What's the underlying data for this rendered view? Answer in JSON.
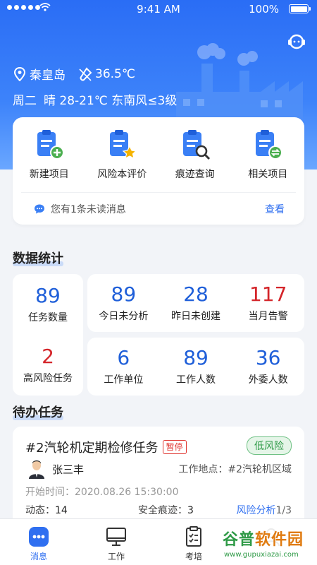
{
  "status_bar": {
    "time": "9:41 AM",
    "battery": "100%"
  },
  "header": {
    "location": "秦皇岛",
    "temperature": "36.5℃",
    "weekday": "周二",
    "weather": "晴 28-21℃ 东南风≤3级"
  },
  "quick_actions": [
    {
      "label": "新建项目",
      "icon": "clipboard-add-icon"
    },
    {
      "label": "风险本评价",
      "icon": "clipboard-star-icon"
    },
    {
      "label": "痕迹查询",
      "icon": "clipboard-search-icon"
    },
    {
      "label": "相关项目",
      "icon": "clipboard-link-icon"
    }
  ],
  "notice": {
    "text": "您有1条未读消息",
    "action": "查看"
  },
  "stats": {
    "title": "数据统计",
    "items": [
      {
        "value": "89",
        "label": "任务数量",
        "color": "#1f5fd9"
      },
      {
        "value": "2",
        "label": "高风险任务",
        "color": "#d4252a"
      },
      {
        "value": "89",
        "label": "今日未分析",
        "color": "#1f5fd9"
      },
      {
        "value": "28",
        "label": "昨日未创建",
        "color": "#1f5fd9"
      },
      {
        "value": "117",
        "label": "当月告警",
        "color": "#d4252a"
      },
      {
        "value": "6",
        "label": "工作单位",
        "color": "#1f5fd9"
      },
      {
        "value": "89",
        "label": "工作人数",
        "color": "#1f5fd9"
      },
      {
        "value": "36",
        "label": "外委人数",
        "color": "#1f5fd9"
      }
    ]
  },
  "todo": {
    "title": "待办任务",
    "task": {
      "title": "#2汽轮机定期检修任务",
      "tag": "暂停",
      "risk": "低风险",
      "person": "张三丰",
      "workplace": "工作地点：#2汽轮机区域",
      "start_time": "开始时间：2020.08.26  15:30:00",
      "dynamic_label": "动态：",
      "dynamic_value": "14",
      "trace_label": "安全痕迹：",
      "trace_value": "3",
      "analysis_label": "风险分析",
      "analysis_progress": "1/3"
    }
  },
  "tabs": [
    {
      "label": "消息",
      "icon": "message-dots-icon",
      "active": true
    },
    {
      "label": "工作",
      "icon": "monitor-icon",
      "active": false
    },
    {
      "label": "考培",
      "icon": "checklist-icon",
      "active": false
    },
    {
      "label": "",
      "icon": "profile-icon",
      "active": false
    }
  ],
  "watermark": {
    "main_green": "谷普",
    "main_orange": "软件园",
    "url": "www.gupuxiazai.com"
  },
  "colors": {
    "primary": "#2f6ff0",
    "danger": "#d4252a",
    "success": "#2f9a47"
  }
}
